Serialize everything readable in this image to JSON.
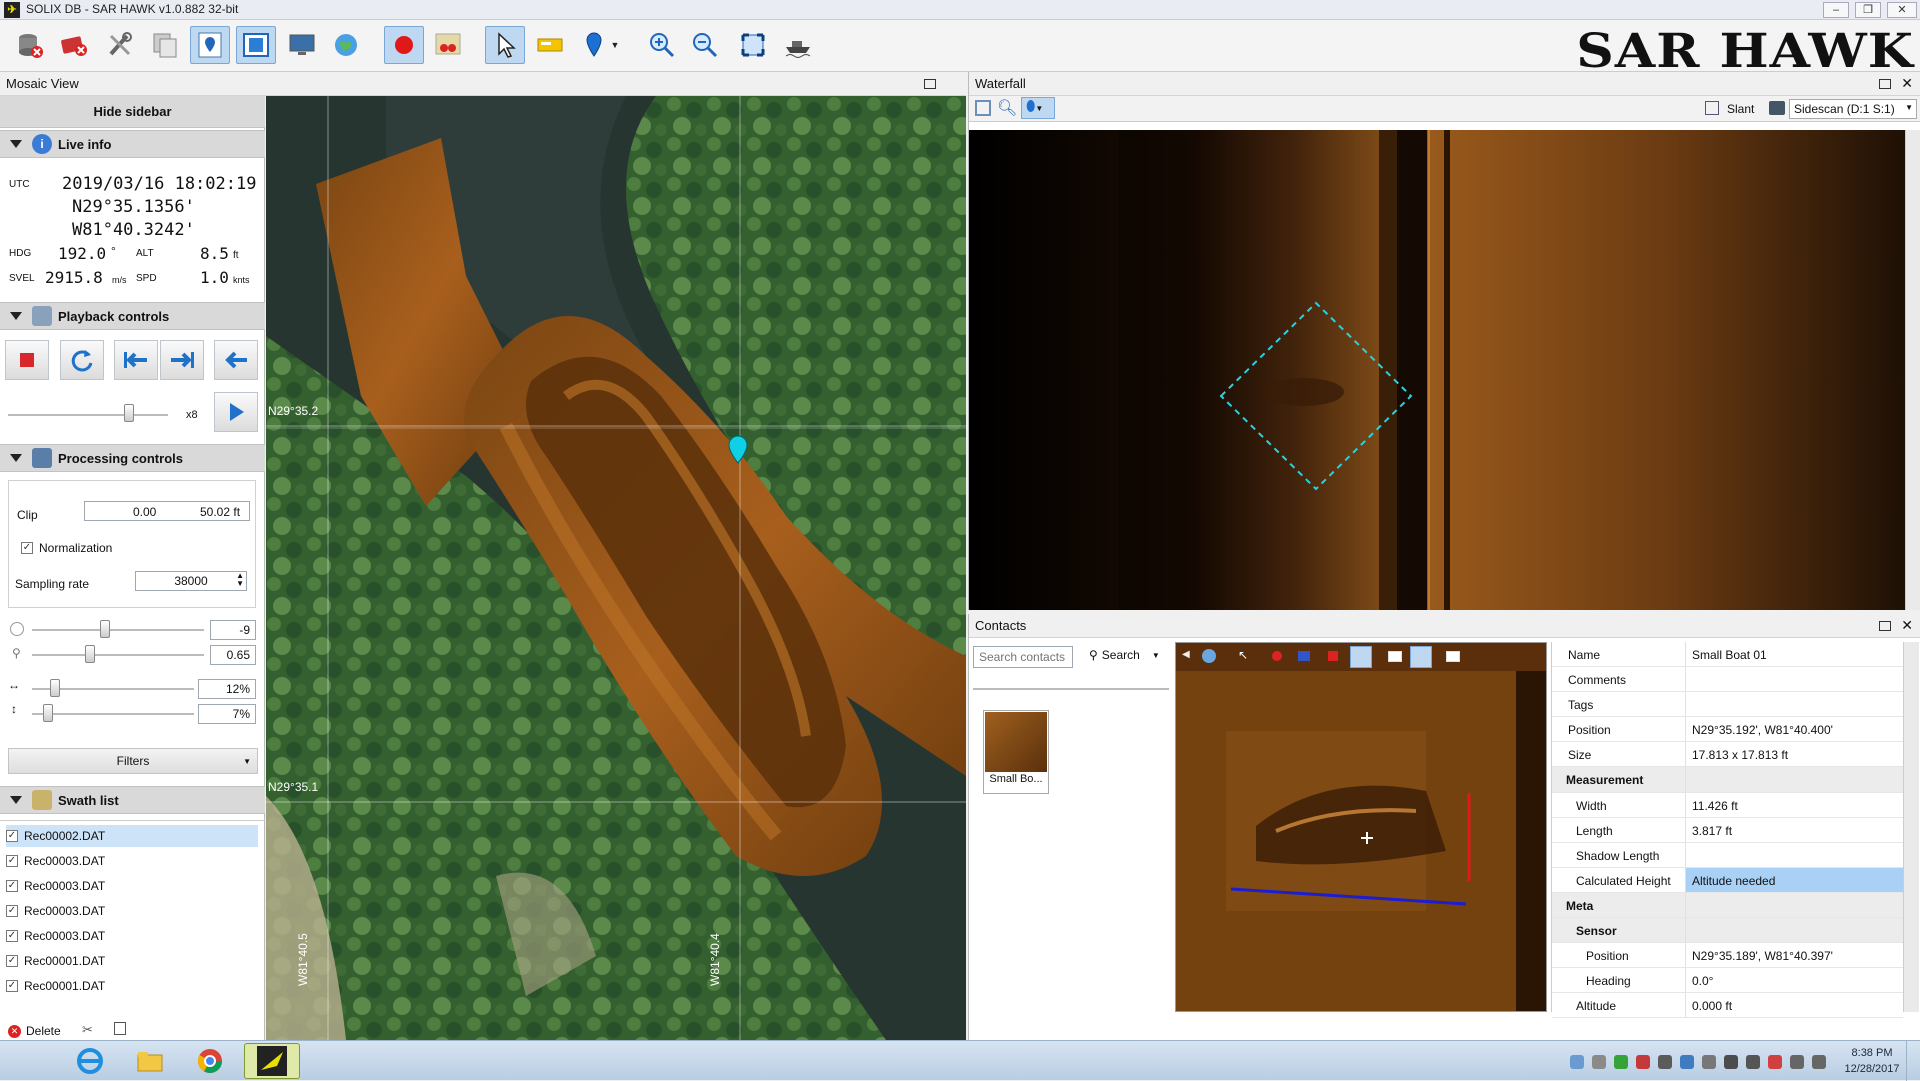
{
  "window": {
    "title": "SOLIX DB - SAR HAWK v1.0.882 32-bit",
    "brand": "SAR HAWK",
    "controls": [
      "–",
      "❐",
      "✕"
    ]
  },
  "toolbar": {
    "buttons": [
      {
        "icon": "database-delete-icon"
      },
      {
        "icon": "delete-tracks-icon"
      },
      {
        "icon": "tools-icon"
      },
      {
        "icon": "copy-layers-icon"
      },
      {
        "icon": "mosaic-pin-icon",
        "active": true
      },
      {
        "icon": "split-view-icon",
        "active": true
      },
      {
        "icon": "monitor-icon"
      },
      {
        "icon": "globe-icon"
      },
      {
        "icon": "record-icon",
        "active": true
      },
      {
        "icon": "map-markers-icon"
      },
      {
        "icon": "select-pointer-icon",
        "active": true
      },
      {
        "icon": "ruler-icon"
      },
      {
        "icon": "place-marker-icon"
      },
      {
        "icon": "zoom-in-icon"
      },
      {
        "icon": "zoom-out-icon"
      },
      {
        "icon": "fit-extent-icon"
      },
      {
        "icon": "boat-icon"
      }
    ]
  },
  "mosaic_view": {
    "title": "Mosaic View",
    "hide_sidebar_label": "Hide sidebar",
    "live_info": {
      "header": "Live info",
      "utc_label": "UTC",
      "utc_value": "2019/03/16 18:02:19",
      "lat": "N29°35.1356'",
      "lon": "W81°40.3242'",
      "hdg_label": "HDG",
      "hdg_value": "192.0",
      "hdg_unit": "°",
      "alt_label": "ALT",
      "alt_value": "8.5",
      "alt_unit": "ft",
      "svel_label": "SVEL",
      "svel_value": "2915.8",
      "svel_unit": "m/s",
      "spd_label": "SPD",
      "spd_value": "1.0",
      "spd_unit": "knts"
    },
    "playback": {
      "header": "Playback controls",
      "speed_label": "x8",
      "speed_level": 0.77
    },
    "processing": {
      "header": "Processing controls",
      "clip_label": "Clip",
      "clip_min": "0.00",
      "clip_max": "50.02 ft",
      "normalization_label": "Normalization",
      "normalization_checked": true,
      "sampling_label": "Sampling rate",
      "sampling_value": "38000",
      "sliders": [
        {
          "icon": "brightness-icon",
          "value": "-9",
          "level": 0.42
        },
        {
          "icon": "gain-icon",
          "value": "0.65",
          "level": 0.33
        },
        {
          "icon": "horizontal-scale-icon",
          "value": "12%",
          "level": 0.12
        },
        {
          "icon": "vertical-scale-icon",
          "value": "7%",
          "level": 0.07
        }
      ],
      "filters_label": "Filters"
    },
    "swath_list": {
      "header": "Swath list",
      "items": [
        {
          "name": "Rec00002.DAT",
          "selected": true
        },
        {
          "name": "Rec00003.DAT"
        },
        {
          "name": "Rec00003.DAT"
        },
        {
          "name": "Rec00003.DAT"
        },
        {
          "name": "Rec00003.DAT"
        },
        {
          "name": "Rec00001.DAT"
        },
        {
          "name": "Rec00001.DAT"
        }
      ],
      "delete_label": "Delete"
    },
    "map": {
      "grid_lat_top": "N29°35.2",
      "grid_lat_bottom": "N29°35.1",
      "grid_lon_left": "W81°40.5",
      "grid_lon_right": "W81°40.4"
    }
  },
  "waterfall": {
    "title": "Waterfall",
    "slant_label": "Slant",
    "sidescan_label": "Sidescan (D:1 S:1)"
  },
  "contacts": {
    "title": "Contacts",
    "search_placeholder": "Search contacts",
    "search_button": "Search",
    "thumbnail_label": "Small Bo...",
    "properties": {
      "name_label": "Name",
      "name_value": "Small Boat  01",
      "comments_label": "Comments",
      "comments_value": "",
      "tags_label": "Tags",
      "tags_value": "",
      "position_label": "Position",
      "position_value": "N29°35.192', W81°40.400'",
      "size_label": "Size",
      "size_value": "17.813 x 17.813 ft",
      "measurement_label": "Measurement",
      "width_label": "Width",
      "width_value": "11.426 ft",
      "length_label": "Length",
      "length_value": "3.817 ft",
      "shadow_label": "Shadow Length",
      "shadow_value": "",
      "calc_height_label": "Calculated Height",
      "calc_height_value": "Altitude needed",
      "meta_label": "Meta",
      "sensor_label": "Sensor",
      "sensor_position_label": "Position",
      "sensor_position_value": "N29°35.189', W81°40.397'",
      "heading_label": "Heading",
      "heading_value": "0.0°",
      "altitude_label": "Altitude",
      "altitude_value": "0.000 ft"
    }
  },
  "taskbar": {
    "apps": [
      "internet-explorer-icon",
      "file-explorer-icon",
      "chrome-icon",
      "sar-hawk-icon"
    ],
    "time": "8:38 PM",
    "date": "12/28/2017"
  }
}
